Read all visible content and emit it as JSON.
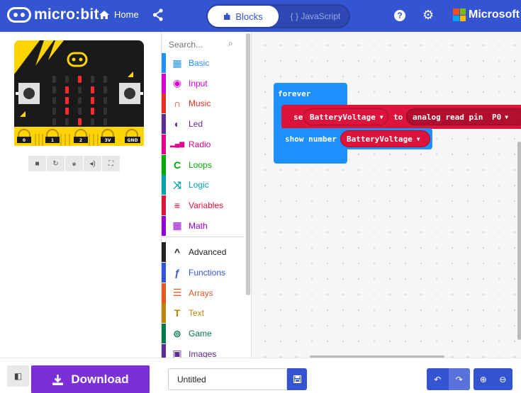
{
  "header": {
    "logo_text": "micro:bit",
    "home_label": "Home",
    "tab_blocks_label": "Blocks",
    "tab_js_label": "{ } JavaScript",
    "brand_label": "Microsoft"
  },
  "simulator": {
    "pins": [
      "0",
      "1",
      "2",
      "3V",
      "GND"
    ],
    "led_color": "#ff2a2a"
  },
  "toolbox": {
    "search_placeholder": "Search...",
    "categories": [
      {
        "label": "Basic",
        "color": "#1e90ff",
        "icon": "grid-icon"
      },
      {
        "label": "Input",
        "color": "#d400d4",
        "icon": "target-icon"
      },
      {
        "label": "Music",
        "color": "#e63022",
        "icon": "headphones-icon"
      },
      {
        "label": "Led",
        "color": "#5c2d91",
        "icon": "toggle-icon"
      },
      {
        "label": "Radio",
        "color": "#e3008c",
        "icon": "signal-bars-icon"
      },
      {
        "label": "Loops",
        "color": "#00aa00",
        "icon": "loop-arrow-icon"
      },
      {
        "label": "Logic",
        "color": "#00a4a6",
        "icon": "shuffle-icon"
      },
      {
        "label": "Variables",
        "color": "#dc143c",
        "icon": "lines-icon"
      },
      {
        "label": "Math",
        "color": "#9400d3",
        "icon": "calculator-icon"
      },
      {
        "label": "Advanced",
        "color": "#222222",
        "icon": "chevron-up-icon"
      },
      {
        "label": "Functions",
        "color": "#3455db",
        "icon": "function-icon"
      },
      {
        "label": "Arrays",
        "color": "#e65722",
        "icon": "list-icon"
      },
      {
        "label": "Text",
        "color": "#b8860b",
        "icon": "text-icon"
      },
      {
        "label": "Game",
        "color": "#007a4b",
        "icon": "gamepad-icon"
      },
      {
        "label": "Images",
        "color": "#5c2d91",
        "icon": "image-icon"
      }
    ]
  },
  "workspace": {
    "forever_label": "forever",
    "set_label": "set",
    "var_name": "BatteryVoltage",
    "to_label": "to",
    "analog_label": "analog read pin",
    "pin_value": "P0",
    "show_number_label": "show number"
  },
  "bottom": {
    "download_label": "Download",
    "project_name": "Untitled"
  }
}
